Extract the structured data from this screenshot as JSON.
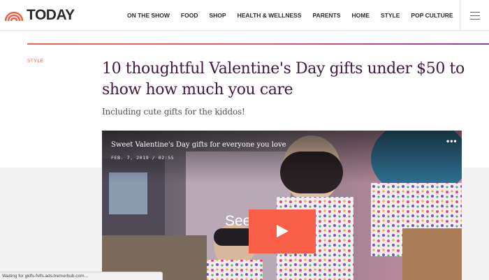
{
  "header": {
    "logo_text": "TODAY",
    "nav": [
      {
        "label": "ON THE SHOW"
      },
      {
        "label": "FOOD"
      },
      {
        "label": "SHOP"
      },
      {
        "label": "HEALTH & WELLNESS"
      },
      {
        "label": "PARENTS"
      },
      {
        "label": "HOME"
      },
      {
        "label": "STYLE"
      },
      {
        "label": "POP CULTURE"
      }
    ]
  },
  "article": {
    "section": "STYLE",
    "headline": "10 thoughtful Valentine's Day gifts under $50 to show how much you care",
    "dek": "Including cute gifts for the kiddos!"
  },
  "video": {
    "title": "Sweet Valentine's Day gifts for everyone you love",
    "date": "FEB. 7, 2019 / 02:55",
    "overlay_text": "See the Clip",
    "more_label": "•••"
  },
  "status": {
    "text": "Waiting for gklfs-fvlfs.ads.tremorhub.com..."
  },
  "colors": {
    "accent": "#fa5f48",
    "headline": "#3e1a3c",
    "gradient_end": "#8d3c9f"
  }
}
